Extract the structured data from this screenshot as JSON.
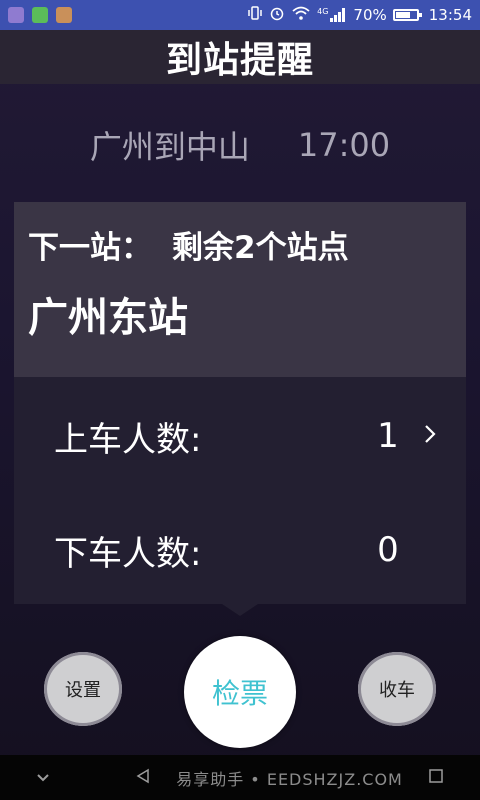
{
  "status_bar": {
    "battery_percent": "70%",
    "battery_level": 0.7,
    "time": "13:54",
    "network": "4G",
    "icons": [
      "gallery-app-icon",
      "wechat-icon",
      "notification-app-icon",
      "vibrate-icon",
      "alarm-icon",
      "wifi-icon",
      "signal-icon"
    ]
  },
  "header": {
    "title": "到站提醒"
  },
  "route": {
    "text": "广州到中山",
    "time": "17:00"
  },
  "card": {
    "next_label": "下一站：",
    "remaining": "剩余2个站点",
    "station": "广州东站",
    "boarding_label": "上车人数:",
    "boarding_value": "1",
    "alighting_label": "下车人数:",
    "alighting_value": "0"
  },
  "buttons": {
    "settings": "设置",
    "check_ticket": "检票",
    "close": "收车"
  },
  "nav": {
    "watermark": "易享助手 • EEDSHZJZ.COM"
  },
  "colors": {
    "status_bar": "#3d51b0",
    "accent_cyan": "#3fc2d0",
    "background": "#1b1530"
  }
}
